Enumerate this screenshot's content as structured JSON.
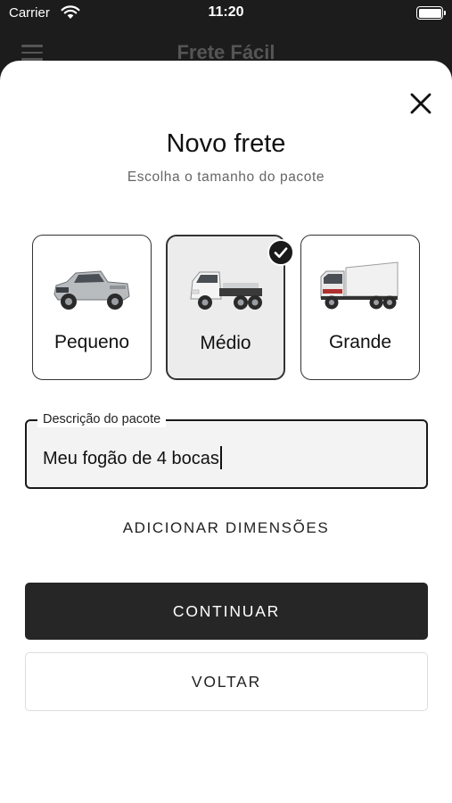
{
  "status_bar": {
    "carrier": "Carrier",
    "time": "11:20"
  },
  "app_bar": {
    "title": "Frete Fácil"
  },
  "sheet": {
    "title": "Novo frete",
    "subtitle": "Escolha o tamanho do pacote",
    "sizes": [
      {
        "label": "Pequeno",
        "icon": "pickup-truck-icon",
        "selected": false
      },
      {
        "label": "Médio",
        "icon": "light-truck-icon",
        "selected": true
      },
      {
        "label": "Grande",
        "icon": "box-truck-icon",
        "selected": false
      }
    ],
    "description_field": {
      "label": "Descrição do pacote",
      "value": "Meu fogão de 4 bocas"
    },
    "add_dimensions": "ADICIONAR DIMENSÕES",
    "continue_button": "CONTINUAR",
    "back_button": "VOLTAR"
  }
}
